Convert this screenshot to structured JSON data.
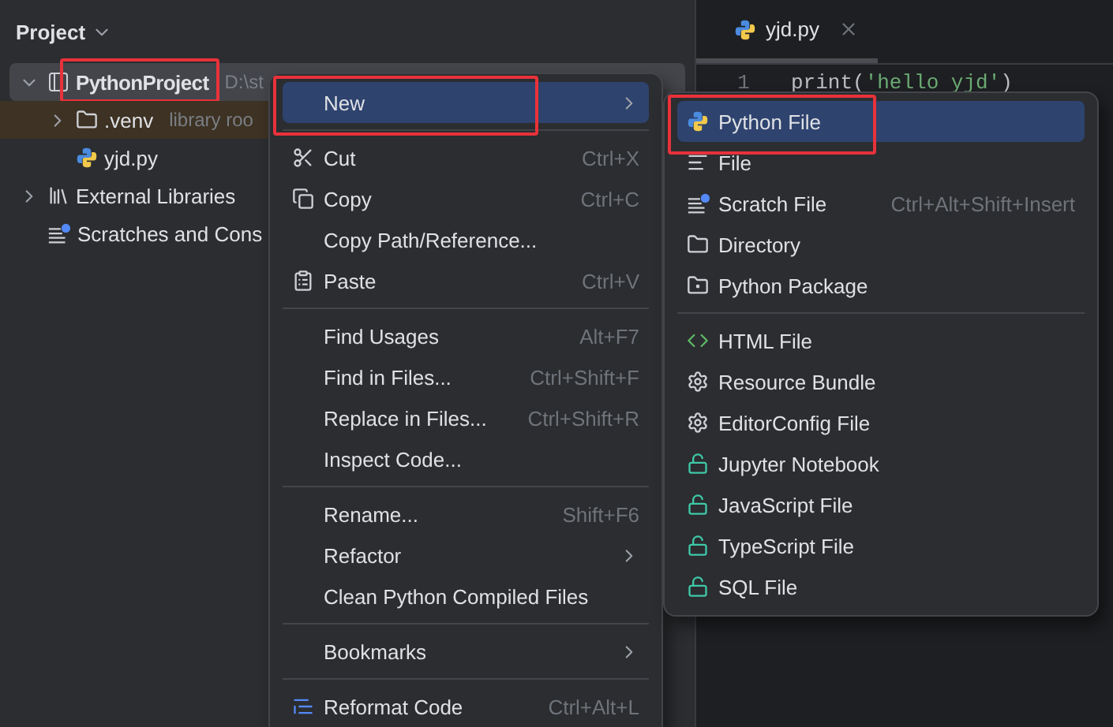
{
  "sidebar": {
    "title": "Project",
    "tree": [
      {
        "label": "PythonProject",
        "path": "D:\\st",
        "expanded": true,
        "selected": true,
        "excluded": false,
        "annotated": true,
        "children": [
          {
            "label": ".venv",
            "hint": "library roo",
            "expanded": false,
            "selected": false,
            "excluded": true
          },
          {
            "label": "yjd.py",
            "selected": false,
            "excluded": false
          }
        ]
      },
      {
        "label": "External Libraries",
        "expanded": false,
        "selected": false,
        "excluded": false
      },
      {
        "label": "Scratches and Cons",
        "selected": false,
        "excluded": false
      }
    ]
  },
  "editor": {
    "tabs": [
      {
        "label": "yjd.py",
        "selected": true
      }
    ],
    "lines": [
      {
        "number": "1",
        "tokens": [
          {
            "text": "print",
            "kind": "plain"
          },
          {
            "text": "(",
            "kind": "plain"
          },
          {
            "text": "'hello yjd'",
            "kind": "string"
          },
          {
            "text": ")",
            "kind": "plain"
          }
        ]
      }
    ]
  },
  "context_menu": {
    "items": [
      {
        "kind": "item",
        "label": "New",
        "submenu": true,
        "selected": true,
        "annotated": true
      },
      {
        "kind": "separator"
      },
      {
        "kind": "item",
        "label": "Cut",
        "shortcut": "Ctrl+X",
        "submenu": false,
        "selected": false,
        "annotated": false
      },
      {
        "kind": "item",
        "label": "Copy",
        "shortcut": "Ctrl+C",
        "submenu": false,
        "selected": false,
        "annotated": false
      },
      {
        "kind": "item",
        "label": "Copy Path/Reference...",
        "submenu": false,
        "selected": false,
        "annotated": false
      },
      {
        "kind": "item",
        "label": "Paste",
        "shortcut": "Ctrl+V",
        "submenu": false,
        "selected": false,
        "annotated": false
      },
      {
        "kind": "separator"
      },
      {
        "kind": "item",
        "label": "Find Usages",
        "shortcut": "Alt+F7",
        "submenu": false,
        "selected": false,
        "annotated": false
      },
      {
        "kind": "item",
        "label": "Find in Files...",
        "shortcut": "Ctrl+Shift+F",
        "submenu": false,
        "selected": false,
        "annotated": false
      },
      {
        "kind": "item",
        "label": "Replace in Files...",
        "shortcut": "Ctrl+Shift+R",
        "submenu": false,
        "selected": false,
        "annotated": false
      },
      {
        "kind": "item",
        "label": "Inspect Code...",
        "submenu": false,
        "selected": false,
        "annotated": false
      },
      {
        "kind": "separator"
      },
      {
        "kind": "item",
        "label": "Rename...",
        "shortcut": "Shift+F6",
        "submenu": false,
        "selected": false,
        "annotated": false
      },
      {
        "kind": "item",
        "label": "Refactor",
        "submenu": true,
        "selected": false,
        "annotated": false
      },
      {
        "kind": "item",
        "label": "Clean Python Compiled Files",
        "submenu": false,
        "selected": false,
        "annotated": false
      },
      {
        "kind": "separator"
      },
      {
        "kind": "item",
        "label": "Bookmarks",
        "submenu": true,
        "selected": false,
        "annotated": false
      },
      {
        "kind": "separator"
      },
      {
        "kind": "item",
        "label": "Reformat Code",
        "shortcut": "Ctrl+Alt+L",
        "submenu": false,
        "selected": false,
        "annotated": false
      }
    ]
  },
  "new_submenu": {
    "items": [
      {
        "kind": "item",
        "label": "Python File",
        "selected": true,
        "annotated": true
      },
      {
        "kind": "item",
        "label": "File",
        "selected": false,
        "annotated": false
      },
      {
        "kind": "item",
        "label": "Scratch File",
        "shortcut": "Ctrl+Alt+Shift+Insert",
        "selected": false,
        "annotated": false
      },
      {
        "kind": "item",
        "label": "Directory",
        "selected": false,
        "annotated": false
      },
      {
        "kind": "item",
        "label": "Python Package",
        "selected": false,
        "annotated": false
      },
      {
        "kind": "separator"
      },
      {
        "kind": "item",
        "label": "HTML File",
        "selected": false,
        "annotated": false
      },
      {
        "kind": "item",
        "label": "Resource Bundle",
        "selected": false,
        "annotated": false
      },
      {
        "kind": "item",
        "label": "EditorConfig File",
        "selected": false,
        "annotated": false
      },
      {
        "kind": "item",
        "label": "Jupyter Notebook",
        "selected": false,
        "annotated": false
      },
      {
        "kind": "item",
        "label": "JavaScript File",
        "selected": false,
        "annotated": false
      },
      {
        "kind": "item",
        "label": "TypeScript File",
        "selected": false,
        "annotated": false
      },
      {
        "kind": "item",
        "label": "SQL File",
        "selected": false,
        "annotated": false
      }
    ]
  }
}
